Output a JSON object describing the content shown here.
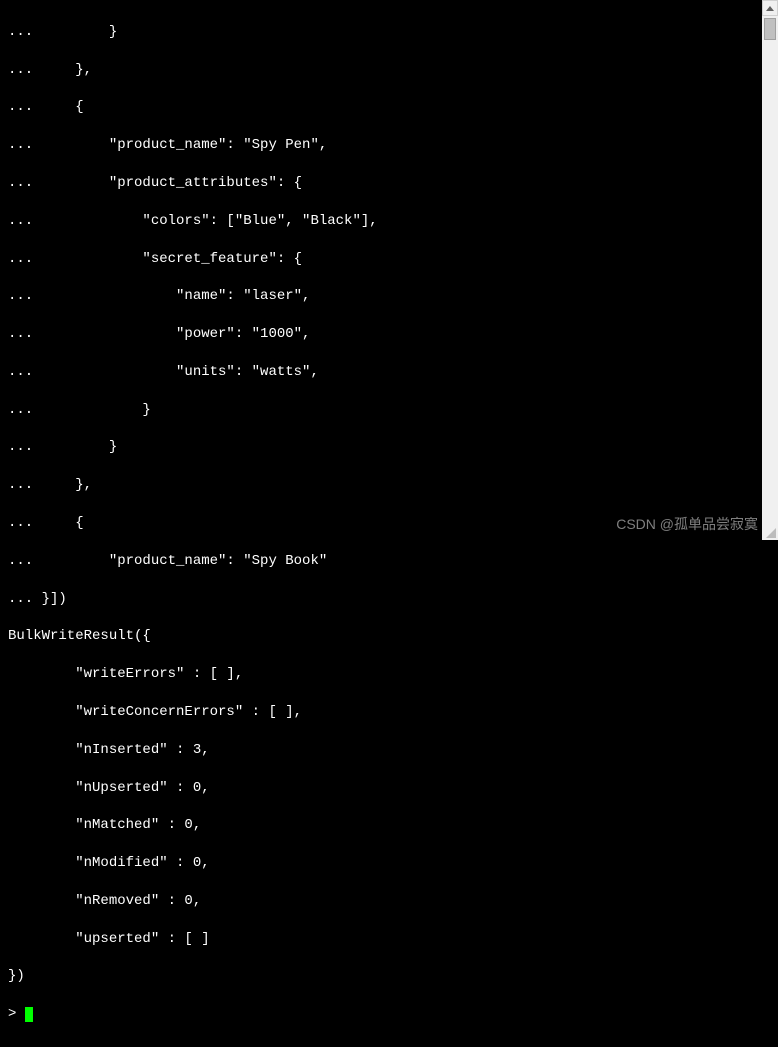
{
  "terminal": {
    "lines": [
      "...         }",
      "...     },",
      "...     {",
      "...         \"product_name\": \"Spy Pen\",",
      "...         \"product_attributes\": {",
      "...             \"colors\": [\"Blue\", \"Black\"],",
      "...             \"secret_feature\": {",
      "...                 \"name\": \"laser\",",
      "...                 \"power\": \"1000\",",
      "...                 \"units\": \"watts\",",
      "...             }",
      "...         }",
      "...     },",
      "...     {",
      "...         \"product_name\": \"Spy Book\"",
      "... }])",
      "BulkWriteResult({",
      "        \"writeErrors\" : [ ],",
      "        \"writeConcernErrors\" : [ ],",
      "        \"nInserted\" : 3,",
      "        \"nUpserted\" : 0,",
      "        \"nMatched\" : 0,",
      "        \"nModified\" : 0,",
      "        \"nRemoved\" : 0,",
      "        \"upserted\" : [ ]",
      "})",
      "> "
    ],
    "prompt": "> "
  },
  "watermark": "CSDN @孤单品尝寂寞"
}
